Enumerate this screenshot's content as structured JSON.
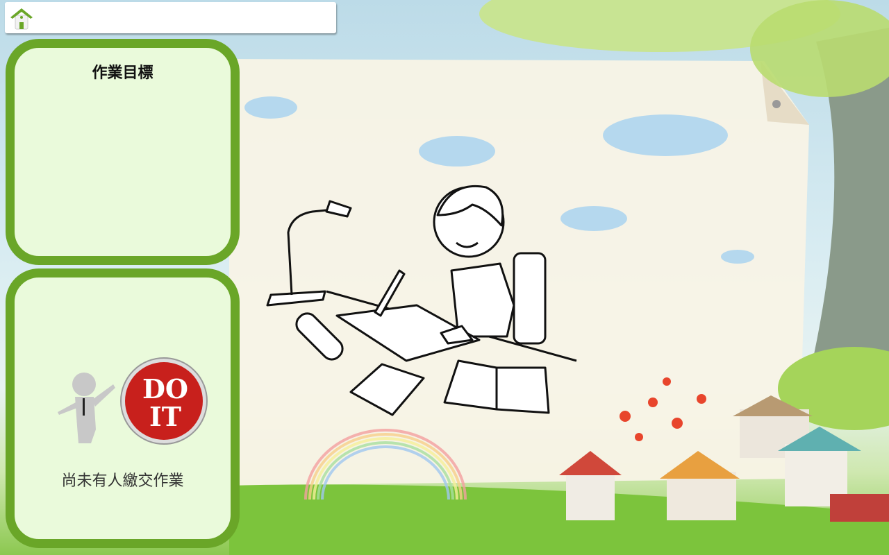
{
  "topbar": {
    "home_icon": "home-icon"
  },
  "goal_panel": {
    "title": "作業目標"
  },
  "submission_panel": {
    "button_text_line1": "DO",
    "button_text_line2": "IT",
    "status": "尚未有人繳交作業"
  },
  "colors": {
    "panel_border": "#6aa628",
    "panel_fill": "#eafadb",
    "button_red": "#c8201c"
  }
}
